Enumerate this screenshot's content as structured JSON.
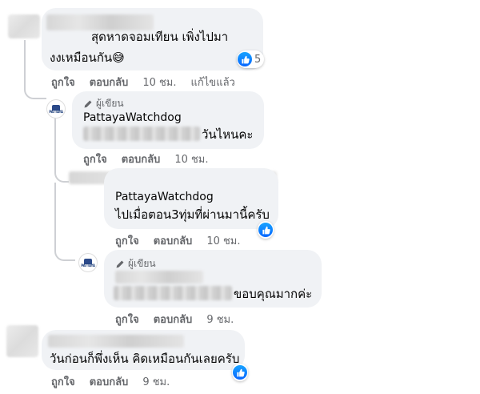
{
  "comments": [
    {
      "text_line1": "สุดหาดจอมเทียน เพิ่งไปมา",
      "text_line2": "งงเหมือนกัน😅",
      "reaction_count": "5",
      "actions": {
        "like": "ถูกใจ",
        "reply": "ตอบกลับ",
        "time": "10 ชม.",
        "edit": "แก้ไขแล้ว"
      }
    },
    {
      "author_badge": "ผู้เขียน",
      "name": "PattayaWatchdog",
      "text": "วันไหนคะ",
      "actions": {
        "like": "ถูกใจ",
        "reply": "ตอบกลับ",
        "time": "10 ชม."
      }
    },
    {
      "name": "PattayaWatchdog",
      "text": "ไปเมื่อตอน3ทุ่มที่ผ่านมานี้ครับ",
      "actions": {
        "like": "ถูกใจ",
        "reply": "ตอบกลับ",
        "time": "10 ชม."
      }
    },
    {
      "author_badge": "ผู้เขียน",
      "text": "ขอบคุณมากค่ะ",
      "actions": {
        "like": "ถูกใจ",
        "reply": "ตอบกลับ",
        "time": "9 ชม."
      }
    },
    {
      "text": "วันก่อนก็พึ่งเห็น คิดเหมือนกันเลยครับ",
      "actions": {
        "like": "ถูกใจ",
        "reply": "ตอบกลับ",
        "time": "9 ชม."
      }
    }
  ],
  "logo_text": "PATTAYA",
  "icons": {
    "reaction": "like-icon",
    "author_badge": "pencil-icon"
  },
  "colors": {
    "bubble": "#f0f2f5",
    "meta_text": "#65676b",
    "like_blue": "#0866ff"
  }
}
